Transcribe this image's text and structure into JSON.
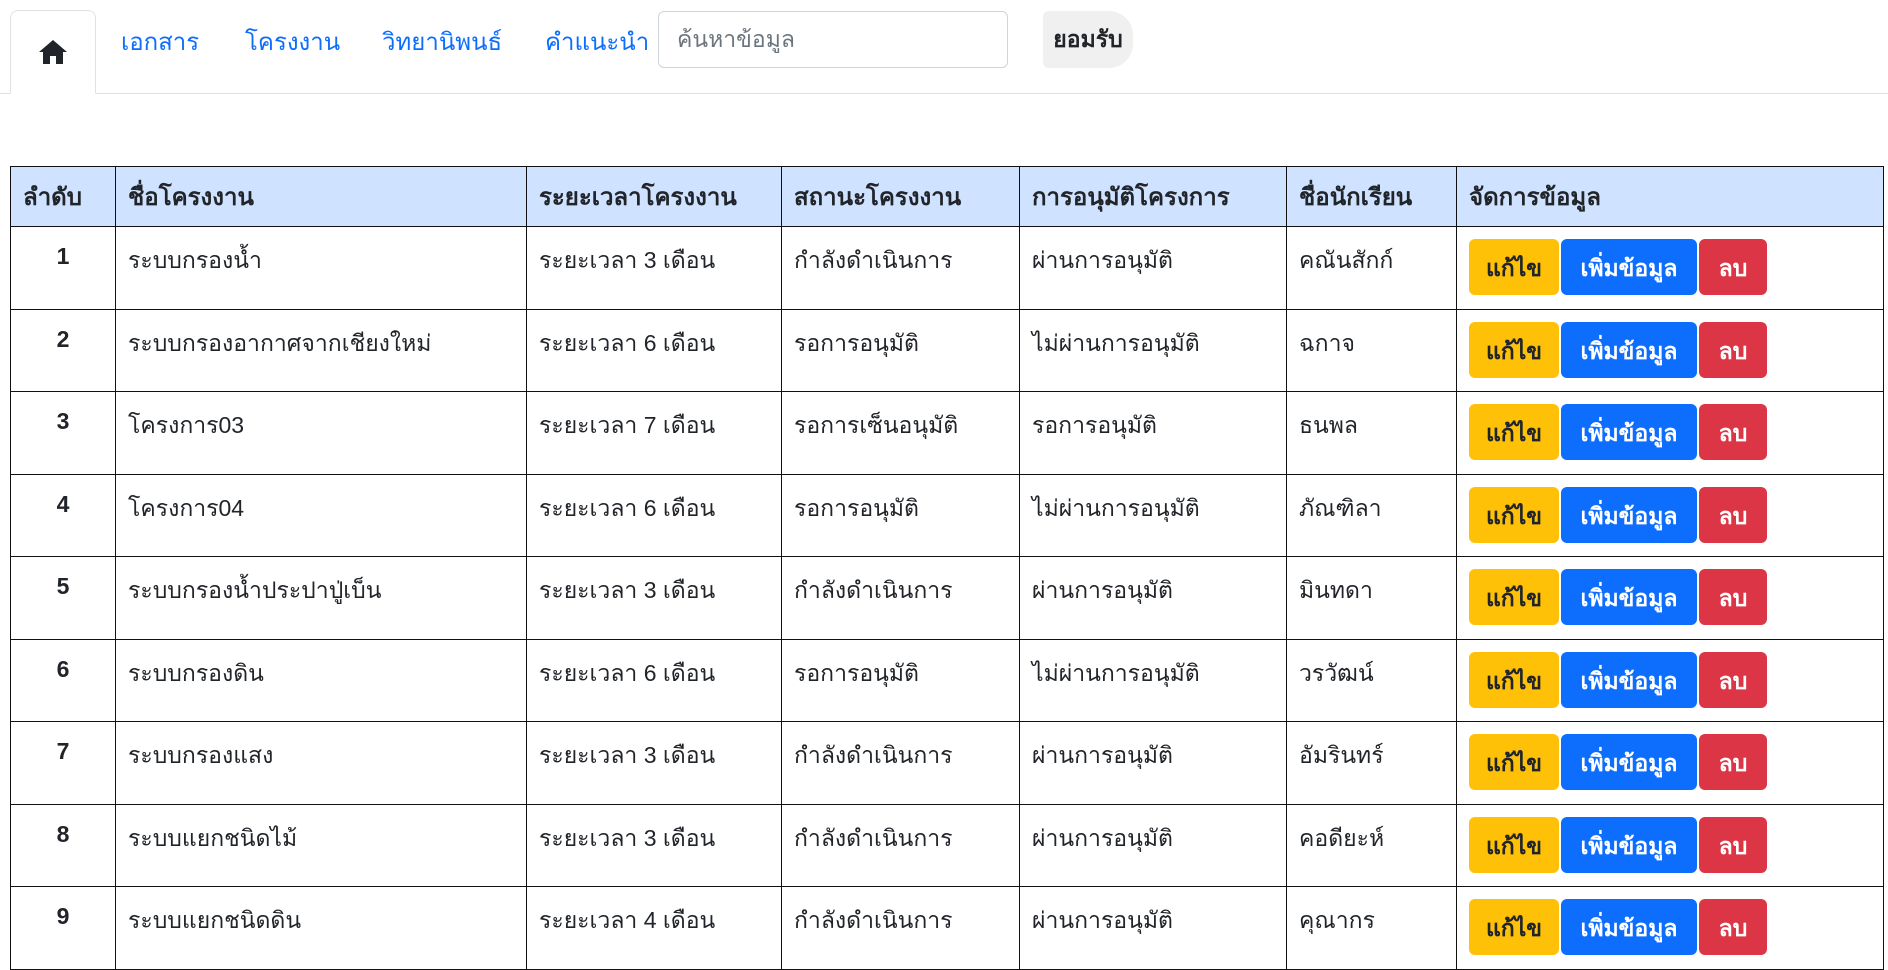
{
  "nav": {
    "home_icon": "home-icon",
    "links": [
      "เอกสาร",
      "โครงงาน",
      "วิทยานิพนธ์",
      "คำแนะนำ"
    ],
    "search_placeholder": "ค้นหาข้อมูล",
    "accept_label": "ยอมรับ"
  },
  "table": {
    "headers": [
      "ลำดับ",
      "ชื่อโครงงาน",
      "ระยะเวลาโครงงาน",
      "สถานะโครงงาน",
      "การอนุมัติโครงการ",
      "ชื่อนักเรียน",
      "จัดการข้อมูล"
    ],
    "action_labels": {
      "edit": "แก้ไข",
      "add": "เพิ่มข้อมูล",
      "delete": "ลบ"
    },
    "rows": [
      {
        "no": "1",
        "name": "ระบบกรองน้ำ",
        "duration": "ระยะเวลา 3 เดือน",
        "status": "กำลังดำเนินการ",
        "approval": "ผ่านการอนุมัติ",
        "student": "คณันสักก์"
      },
      {
        "no": "2",
        "name": "ระบบกรองอากาศจากเชียงใหม่",
        "duration": "ระยะเวลา 6 เดือน",
        "status": "รอการอนุมัติ",
        "approval": "ไม่ผ่านการอนุมัติ",
        "student": "ฉกาจ"
      },
      {
        "no": "3",
        "name": "โครงการ03",
        "duration": "ระยะเวลา 7 เดือน",
        "status": "รอการเซ็นอนุมัติ",
        "approval": "รอการอนุมัติ",
        "student": "ธนพล"
      },
      {
        "no": "4",
        "name": "โครงการ04",
        "duration": "ระยะเวลา 6 เดือน",
        "status": "รอการอนุมัติ",
        "approval": "ไม่ผ่านการอนุมัติ",
        "student": "ภัณฑิลา"
      },
      {
        "no": "5",
        "name": "ระบบกรองน้ำประปาปู่เบ็น",
        "duration": "ระยะเวลา 3 เดือน",
        "status": "กำลังดำเนินการ",
        "approval": "ผ่านการอนุมัติ",
        "student": "มินทดา"
      },
      {
        "no": "6",
        "name": "ระบบกรองดิน",
        "duration": "ระยะเวลา 6 เดือน",
        "status": "รอการอนุมัติ",
        "approval": "ไม่ผ่านการอนุมัติ",
        "student": "วรวัฒน์"
      },
      {
        "no": "7",
        "name": "ระบบกรองแสง",
        "duration": "ระยะเวลา 3 เดือน",
        "status": "กำลังดำเนินการ",
        "approval": "ผ่านการอนุมัติ",
        "student": "อัมรินทร์"
      },
      {
        "no": "8",
        "name": "ระบบแยกชนิดไม้",
        "duration": "ระยะเวลา 3 เดือน",
        "status": "กำลังดำเนินการ",
        "approval": "ผ่านการอนุมัติ",
        "student": "คอดียะห์"
      },
      {
        "no": "9",
        "name": "ระบบแยกชนิดดิน",
        "duration": "ระยะเวลา 4 เดือน",
        "status": "กำลังดำเนินการ",
        "approval": "ผ่านการอนุมัติ",
        "student": "คุณากร"
      }
    ]
  },
  "colors": {
    "link": "#0d6efd",
    "header_bg": "#cfe2ff",
    "edit": "#ffc107",
    "add": "#0d6efd",
    "delete": "#dc3545"
  }
}
